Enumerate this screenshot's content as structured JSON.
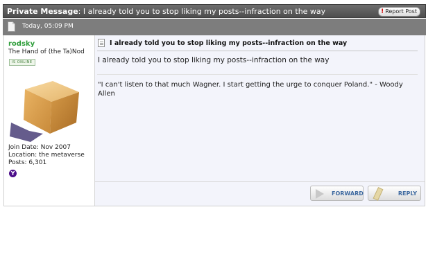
{
  "header": {
    "label": "Private Message",
    "subject": "I already told you to stop liking my posts--infraction on the way",
    "report_button": "Report Post"
  },
  "datebar": {
    "date": "Today, 05:09 PM"
  },
  "user": {
    "name": "rodsky",
    "title": "The Hand of (the Ta)Nod",
    "status_badge": "IS ONLINE",
    "join_date": "Join Date: Nov 2007",
    "location": "Location: the metaverse",
    "posts": "Posts: 6,301",
    "yahoo_icon_glyph": "Y"
  },
  "post": {
    "title": "I already told you to stop liking my posts--infraction on the way",
    "body": "I already told you to stop liking my posts--infraction on the way",
    "signature": "\"I can't listen to that much Wagner. I start getting the urge to conquer Poland.\" - Woody Allen"
  },
  "actions": {
    "forward": "FORWARD",
    "reply": "REPLY"
  },
  "colors": {
    "username": "#2e9d3a",
    "button_text": "#3f6aa0",
    "content_bg": "#f3f4fb"
  }
}
